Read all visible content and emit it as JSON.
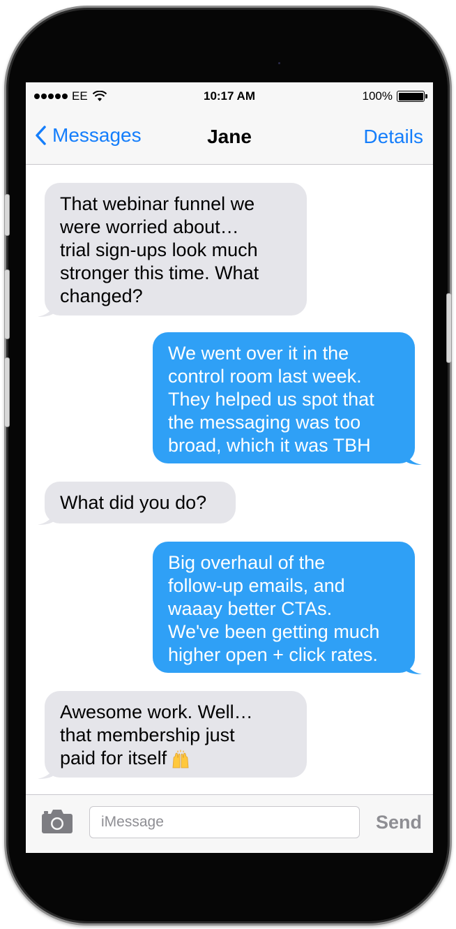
{
  "status_bar": {
    "carrier": "EE",
    "time": "10:17 AM",
    "battery": "100%",
    "battery_level": 1.0,
    "signal_icon": "signal-dots-icon",
    "wifi_icon": "wifi-icon"
  },
  "nav": {
    "back_label": "Messages",
    "title": "Jane",
    "details_label": "Details",
    "back_icon": "chevron-left-icon"
  },
  "messages": [
    {
      "direction": "incoming",
      "lines": [
        "That webinar funnel we",
        "were worried about…",
        "trial sign-ups look much",
        "stronger this time. What",
        "changed?"
      ]
    },
    {
      "direction": "outgoing",
      "lines": [
        "We went over it in the",
        "control room last week.",
        "They helped us spot that",
        "the messaging was too",
        "broad, which it was TBH"
      ]
    },
    {
      "direction": "incoming",
      "lines": [
        "What did you do?"
      ]
    },
    {
      "direction": "outgoing",
      "lines": [
        "Big overhaul of the",
        "follow-up emails, and",
        "waaay better CTAs.",
        "We've been getting much",
        "higher open + click rates."
      ]
    },
    {
      "direction": "incoming",
      "lines": [
        "Awesome work. Well…",
        "that membership just",
        "paid for itself"
      ],
      "trailing_emoji": "raising-hands-emoji"
    }
  ],
  "composer": {
    "placeholder": "iMessage",
    "send_label": "Send",
    "camera_icon": "camera-icon"
  },
  "colors": {
    "incoming_bubble": "#e5e5ea",
    "outgoing_bubble": "#2fa0f6",
    "accent": "#157efb",
    "phone_body": "#060606"
  }
}
